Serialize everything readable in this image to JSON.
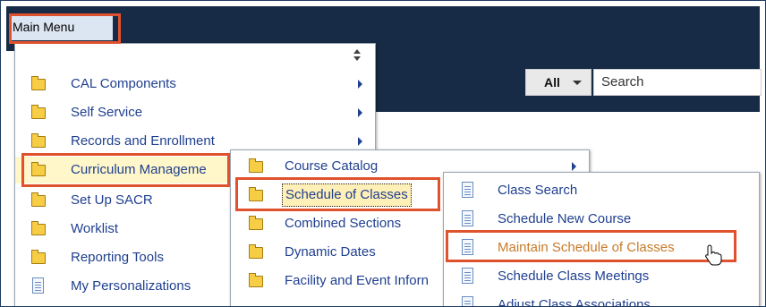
{
  "main_menu": {
    "label": "Main Menu"
  },
  "search": {
    "scope": "All",
    "placeholder": "Search"
  },
  "menu_level1": [
    {
      "label": "CAL Components",
      "icon": "folder-icon",
      "submenu": true
    },
    {
      "label": "Self Service",
      "icon": "folder-icon",
      "submenu": true
    },
    {
      "label": "Records and Enrollment",
      "icon": "folder-icon",
      "submenu": true
    },
    {
      "label": "Curriculum Manageme",
      "icon": "folder-icon",
      "submenu": true,
      "active": true
    },
    {
      "label": "Set Up SACR",
      "icon": "folder-icon",
      "submenu": false
    },
    {
      "label": "Worklist",
      "icon": "folder-icon",
      "submenu": false
    },
    {
      "label": "Reporting Tools",
      "icon": "folder-icon",
      "submenu": false
    },
    {
      "label": "My Personalizations",
      "icon": "document-icon",
      "submenu": false
    }
  ],
  "menu_level2": [
    {
      "label": "Course Catalog",
      "icon": "folder-icon",
      "submenu": true
    },
    {
      "label": "Schedule of Classes",
      "icon": "folder-icon",
      "submenu": false,
      "active": true
    },
    {
      "label": "Combined Sections",
      "icon": "folder-icon",
      "submenu": false
    },
    {
      "label": "Dynamic Dates",
      "icon": "folder-icon",
      "submenu": false
    },
    {
      "label": "Facility and Event Inforn",
      "icon": "folder-icon",
      "submenu": false
    }
  ],
  "menu_level3": [
    {
      "label": "Class Search",
      "icon": "document-icon"
    },
    {
      "label": "Schedule New Course",
      "icon": "document-icon"
    },
    {
      "label": "Maintain Schedule of Classes",
      "icon": "document-icon",
      "hovered": true
    },
    {
      "label": "Schedule Class Meetings",
      "icon": "document-icon"
    },
    {
      "label": "Adjust Class Associations",
      "icon": "document-icon"
    }
  ],
  "colors": {
    "header": "#172b46",
    "menu_text": "#1f3f8f",
    "hover_text": "#c77b2a",
    "callout": "#e0522e"
  }
}
